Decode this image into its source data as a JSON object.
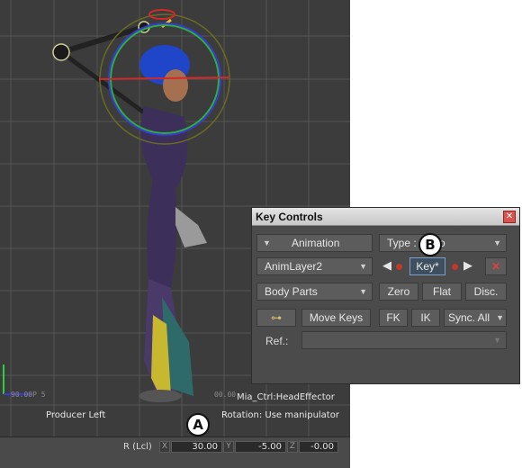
{
  "viewport": {
    "faint_left": "90.00P 5",
    "faint_right": "00.00",
    "producer_label": "Producer Left",
    "selection_name": "Mia_Ctrl:HeadEffector",
    "rotation_mode": "Rotation: Use manipulator"
  },
  "statusbar": {
    "mode_label": "R (Lcl)",
    "x_label": "X",
    "x_value": "30.00",
    "y_label": "Y",
    "y_value": "-5.00",
    "z_label": "Z",
    "z_value": "-0.00"
  },
  "callouts": {
    "a": "A",
    "b": "B"
  },
  "dialog": {
    "title": "Key Controls",
    "close_glyph": "✕",
    "animation_label": "Animation",
    "type_label": "Type :",
    "type_value": "Auto",
    "layer_value": "AnimLayer2",
    "key_label": "Key*",
    "delete_glyph": "✕",
    "body_parts_value": "Body Parts",
    "zero_label": "Zero",
    "flat_label": "Flat",
    "disc_label": "Disc.",
    "move_keys_label": "Move Keys",
    "fk_label": "FK",
    "ik_label": "IK",
    "sync_label": "Sync. All",
    "ref_label": "Ref.:",
    "ref_value": ""
  },
  "icons": {
    "prev_key": "◀",
    "next_key": "▶",
    "dropdown": "▼",
    "key_glyph": "⊶"
  },
  "colors": {
    "viewport_bg": "#3c3c3c",
    "dialog_bg": "#4b4b4b",
    "key_dot": "#c0392b",
    "delete_red": "#e04040",
    "accent_blue": "#7aa0c8"
  }
}
